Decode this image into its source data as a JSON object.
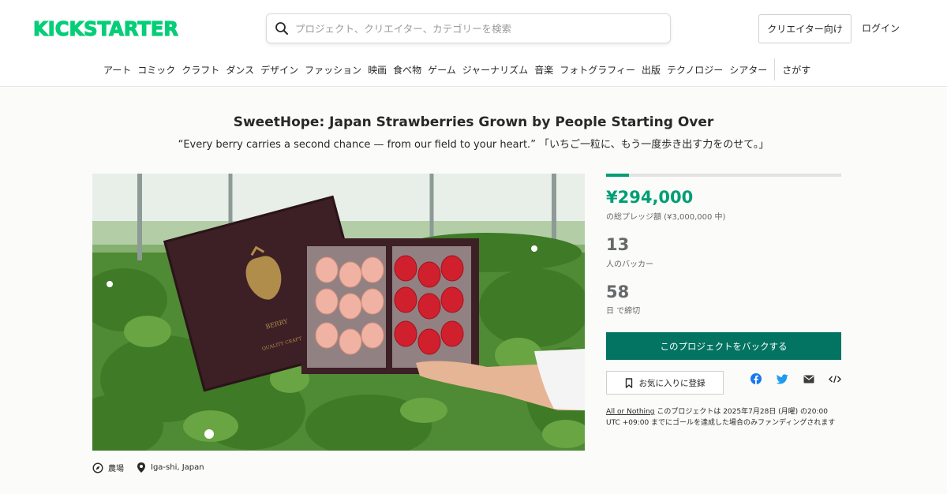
{
  "header": {
    "logo_text": "KICKSTARTER",
    "search_placeholder": "プロジェクト、クリエイター、カテゴリーを検索",
    "creator_button": "クリエイター向け",
    "login": "ログイン",
    "categories": [
      "アート",
      "コミック",
      "クラフト",
      "ダンス",
      "デザイン",
      "ファッション",
      "映画",
      "食べ物",
      "ゲーム",
      "ジャーナリズム",
      "音楽",
      "フォトグラフィー",
      "出版",
      "テクノロジー",
      "シアター"
    ],
    "explore": "さがす"
  },
  "project": {
    "title": "SweetHope: Japan Strawberries Grown by People Starting Over",
    "subtitle": "“Every berry carries a second chance — from our field to your heart.” 「いちご一粒に、もう一度歩き出す力をのせて。」",
    "category": "農場",
    "location": "Iga-shi, Japan",
    "photo_box_text": {
      "brand": "BERRY",
      "quality": "QUALITY CRAFT"
    }
  },
  "stats": {
    "progress_fraction": 0.098,
    "pledged": "¥294,000",
    "pledged_label": "の総プレッジ額 (¥3,000,000 中)",
    "backers": "13",
    "backers_label": "人のバッカー",
    "days": "58",
    "days_label": "日 で締切"
  },
  "actions": {
    "back_button": "このプロジェクトをバックする",
    "remind_button": "お気に入りに登録"
  },
  "fine_print": {
    "link": "All or Nothing",
    "text": " このプロジェクトは 2025年7月28日 (月曜) の20:00 UTC +09:00 までにゴールを達成した場合のみファンディングされます"
  },
  "colors": {
    "brand_green": "#05ce78",
    "pledge_green": "#009e74",
    "button_green": "#037362",
    "facebook": "#1877f2",
    "twitter": "#1d9bf0"
  },
  "icons": {
    "search": "search-icon",
    "compass": "compass-icon",
    "location": "location-pin-icon",
    "bookmark": "bookmark-icon",
    "facebook": "facebook-icon",
    "twitter": "twitter-icon",
    "email": "email-icon",
    "embed": "embed-icon"
  }
}
